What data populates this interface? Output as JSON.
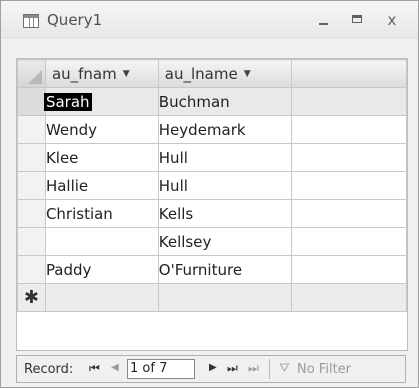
{
  "window": {
    "title": "Query1",
    "close_glyph": "x"
  },
  "grid": {
    "columns": [
      {
        "label": "au_fnam",
        "dropdown_glyph": "▼"
      },
      {
        "label": "au_lname",
        "dropdown_glyph": "▼"
      }
    ],
    "rows": [
      {
        "au_fname": "Sarah",
        "au_lname": "Buchman"
      },
      {
        "au_fname": "Wendy",
        "au_lname": "Heydemark"
      },
      {
        "au_fname": "Klee",
        "au_lname": "Hull"
      },
      {
        "au_fname": "Hallie",
        "au_lname": "Hull"
      },
      {
        "au_fname": "Christian",
        "au_lname": "Kells"
      },
      {
        "au_fname": "",
        "au_lname": "Kellsey"
      },
      {
        "au_fname": "Paddy",
        "au_lname": "O'Furniture"
      }
    ],
    "new_record_marker": "✱"
  },
  "navigation": {
    "record_label": "Record:",
    "first_glyph": "⏮",
    "prev_glyph": "◀",
    "position_value": "1 of 7",
    "next_glyph": "▶",
    "last_glyph": "⏭",
    "new_glyph": "⏭",
    "filter_icon": "funnel-icon",
    "filter_label": "No Filter"
  }
}
